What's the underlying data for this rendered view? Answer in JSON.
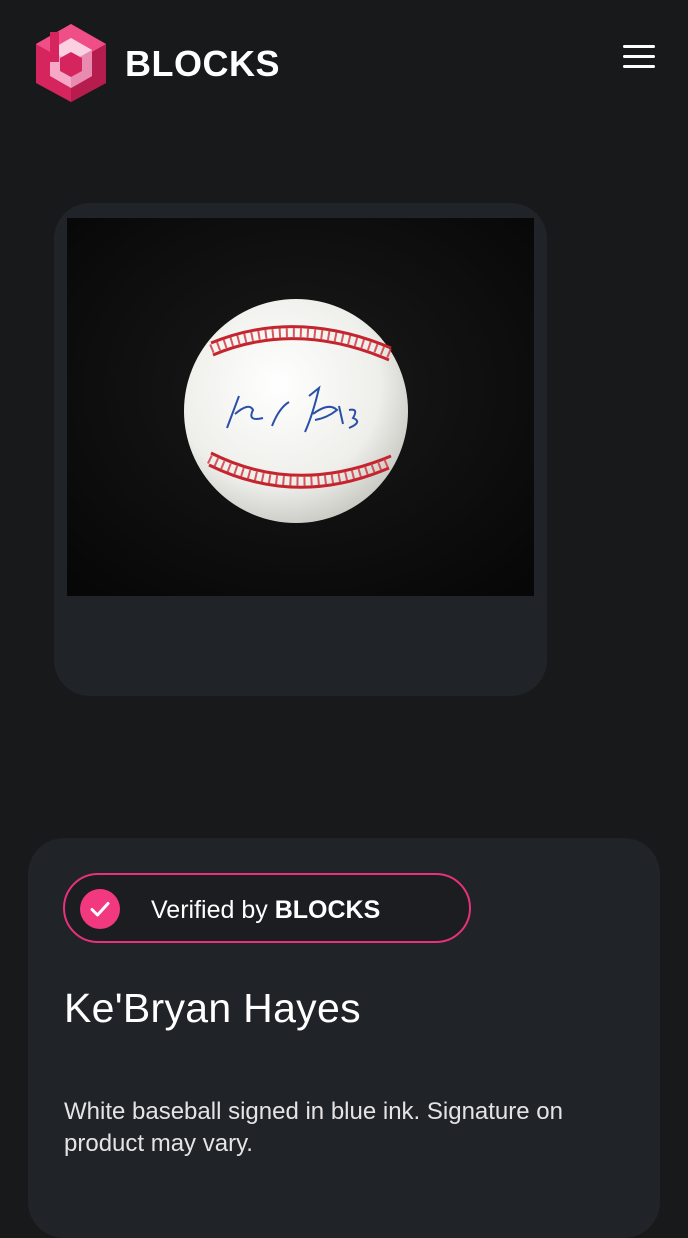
{
  "header": {
    "brand": "BLOCKS",
    "logo_icon": "blocks-hexagon-logo-icon",
    "menu_icon": "hamburger-menu-icon"
  },
  "product": {
    "image_alt": "Autographed baseball",
    "verified_prefix": "Verified by",
    "verified_brand": "BLOCKS",
    "verified_icon": "check-circle-icon",
    "name": "Ke'Bryan Hayes",
    "description": "White baseball signed in blue ink. Signature on product may vary."
  },
  "colors": {
    "background": "#18191b",
    "card": "#202327",
    "accent": "#e8317c"
  }
}
